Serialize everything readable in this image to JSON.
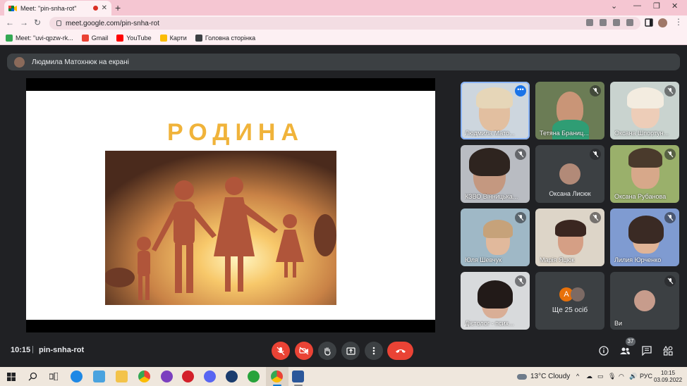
{
  "browser": {
    "tab_title": "Meet: \"pin-snha-rot\"",
    "url": "meet.google.com/pin-snha-rot"
  },
  "bookmarks": [
    {
      "label": "Meet: \"uvi-qpzw-rk...",
      "icon": "meet-icon",
      "color": "#34a853"
    },
    {
      "label": "Gmail",
      "icon": "gmail-icon",
      "color": "#ea4335"
    },
    {
      "label": "YouTube",
      "icon": "youtube-icon",
      "color": "#ff0000"
    },
    {
      "label": "Карти",
      "icon": "maps-icon",
      "color": "#fbbc04"
    },
    {
      "label": "Головна сторінка",
      "icon": "home-page-icon",
      "color": "#3c4043"
    }
  ],
  "meet": {
    "presenter_banner": "Людмила Матохнюк на екрані",
    "slide_title": "РОДИНА",
    "time": "10:15",
    "separator": "|",
    "meeting_code": "pin-snha-rot",
    "participants_count": "37",
    "more_tile_letter": "A",
    "more_tile_label": "Ще 25 осіб",
    "participants": [
      {
        "name": "Людмила Мато...",
        "muted": false,
        "active": true
      },
      {
        "name": "Тетяна Браниц...",
        "muted": true
      },
      {
        "name": "Оксана Шпортун...",
        "muted": true
      },
      {
        "name": "КЗВО Вінницька...",
        "muted": true
      },
      {
        "name": "Оксана Лисюк",
        "muted": true,
        "avatar_only": true
      },
      {
        "name": "Оксана Рубанова",
        "muted": true
      },
      {
        "name": "Юля Шевчук",
        "muted": true
      },
      {
        "name": "Марія Яцюк",
        "muted": true
      },
      {
        "name": "Лилия Юрченко",
        "muted": true
      },
      {
        "name": "Дієтолог - псих...",
        "muted": true
      },
      {
        "name": "Ви",
        "muted": true,
        "avatar_only": true
      }
    ]
  },
  "taskbar": {
    "weather": "13°C  Cloudy",
    "language": "РУС",
    "clock_time": "10:15",
    "clock_date": "03.09.2022"
  }
}
